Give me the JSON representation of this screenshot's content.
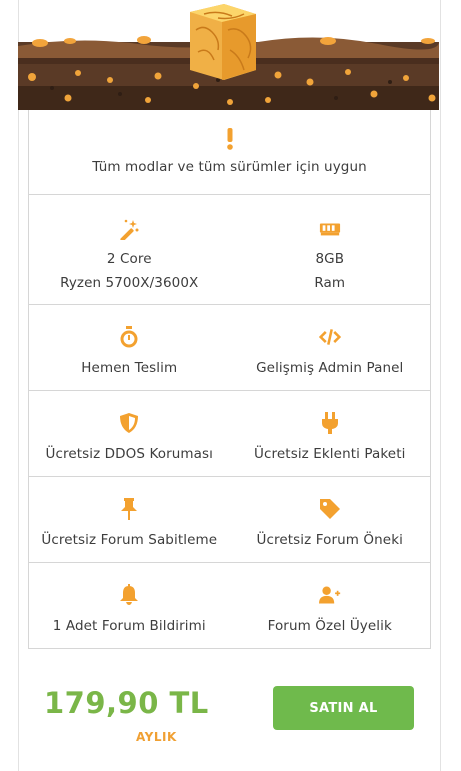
{
  "colors": {
    "accent_orange": "#f3a12f",
    "price_green": "#7ab648",
    "button_green": "#6fba4c",
    "dirt_brown": "#5a3a26"
  },
  "top_note": {
    "icon": "exclamation-icon",
    "text": "Tüm modlar ve tüm sürümler için uygun"
  },
  "features": [
    {
      "icon": "magic-wand-icon",
      "line1": "2 Core",
      "line2": "Ryzen 5700X/3600X"
    },
    {
      "icon": "memory-icon",
      "line1": "8GB",
      "line2": "Ram"
    },
    {
      "icon": "stopwatch-icon",
      "line1": "Hemen Teslim"
    },
    {
      "icon": "code-icon",
      "line1": "Gelişmiş Admin Panel"
    },
    {
      "icon": "shield-icon",
      "line1": "Ücretsiz DDOS Koruması"
    },
    {
      "icon": "plug-icon",
      "line1": "Ücretsiz Eklenti Paketi"
    },
    {
      "icon": "pin-icon",
      "line1": "Ücretsiz Forum Sabitleme"
    },
    {
      "icon": "tag-icon",
      "line1": "Ücretsiz Forum Öneki"
    },
    {
      "icon": "bell-icon",
      "line1": "1 Adet Forum Bildirimi"
    },
    {
      "icon": "user-plus-icon",
      "line1": "Forum Özel Üyelik"
    }
  ],
  "pricing": {
    "price": "179,90 TL",
    "period": "AYLIK",
    "button_label": "SATIN AL"
  }
}
